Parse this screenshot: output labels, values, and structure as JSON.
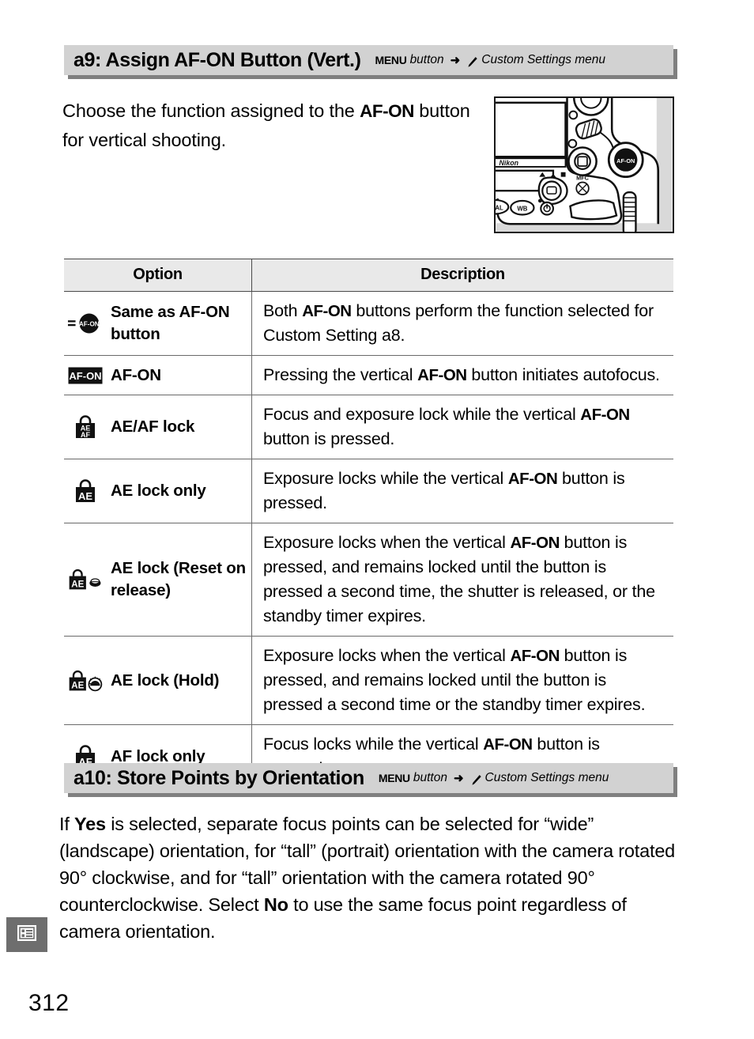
{
  "page": {
    "number": "312",
    "tab_icon": "menu-list-icon"
  },
  "sections": [
    {
      "id": "a9",
      "title": "a9: Assign AF-ON Button (Vert.)",
      "path": {
        "menu_label": "MENU",
        "button_word": "button",
        "arrow": "➜",
        "pencil_icon": "pencil-icon",
        "destination": "Custom Settings menu"
      },
      "intro_lead": "Choose the function assigned to the ",
      "intro_mono": "AF-ON",
      "intro_tail": " button for vertical shooting.",
      "figure": {
        "name": "camera-vertical-grip-illustration",
        "brand_text": "Nikon",
        "labels": [
          "AF-ON",
          "MFC",
          "WB",
          "QUAL"
        ]
      }
    },
    {
      "id": "a10",
      "title": "a10: Store Points by Orientation",
      "path": {
        "menu_label": "MENU",
        "button_word": "button",
        "arrow": "➜",
        "pencil_icon": "pencil-icon",
        "destination": "Custom Settings menu"
      },
      "body": [
        {
          "t": "If ",
          "b": false
        },
        {
          "t": "Yes",
          "b": true
        },
        {
          "t": " is selected, separate focus points can be selected for “wide” (landscape) orientation, for “tall” (portrait) orientation with the camera rotated 90° clockwise, and for “tall” orientation with the camera rotated 90° counterclockwise.  Select ",
          "b": false
        },
        {
          "t": "No",
          "b": true
        },
        {
          "t": " to use the same focus point regardless of camera orientation.",
          "b": false
        }
      ]
    }
  ],
  "table": {
    "headers": {
      "option": "Option",
      "description": "Description"
    },
    "rows": [
      {
        "icon": "equals-afon-circle-icon",
        "icon_text": "AF-ON",
        "label": "Same as AF-ON button",
        "desc_parts": [
          {
            "t": "Both ",
            "m": false
          },
          {
            "t": "AF-ON",
            "m": true
          },
          {
            "t": " buttons perform the function selected for Custom Setting a8.",
            "m": false
          }
        ]
      },
      {
        "icon": "afon-box-icon",
        "icon_text": "AF-ON",
        "label": "AF-ON",
        "desc_parts": [
          {
            "t": "Pressing the vertical ",
            "m": false
          },
          {
            "t": "AF-ON",
            "m": true
          },
          {
            "t": " button initiates autofocus.",
            "m": false
          }
        ]
      },
      {
        "icon": "padlock-ae-af-icon",
        "icon_text": "AE/AF",
        "label": "AE/AF lock",
        "desc_parts": [
          {
            "t": "Focus and exposure lock while the vertical ",
            "m": false
          },
          {
            "t": "AF-ON",
            "m": true
          },
          {
            "t": " button is pressed.",
            "m": false
          }
        ]
      },
      {
        "icon": "padlock-ae-icon",
        "icon_text": "AE",
        "label": "AE lock only",
        "desc_parts": [
          {
            "t": "Exposure locks while the vertical ",
            "m": false
          },
          {
            "t": "AF-ON",
            "m": true
          },
          {
            "t": " button is pressed.",
            "m": false
          }
        ]
      },
      {
        "icon": "padlock-ae-shutter-release-icon",
        "icon_text": "AE",
        "label": "AE lock (Reset on release)",
        "desc_parts": [
          {
            "t": "Exposure locks when the vertical ",
            "m": false
          },
          {
            "t": "AF-ON",
            "m": true
          },
          {
            "t": " button is pressed, and remains locked until the button is pressed a second time, the shutter is released, or the standby timer expires.",
            "m": false
          }
        ]
      },
      {
        "icon": "padlock-ae-timer-icon",
        "icon_text": "AE",
        "label": "AE lock (Hold)",
        "desc_parts": [
          {
            "t": "Exposure locks when the vertical ",
            "m": false
          },
          {
            "t": "AF-ON",
            "m": true
          },
          {
            "t": " button is pressed, and remains locked until the button is pressed a second time or the standby timer expires.",
            "m": false
          }
        ]
      },
      {
        "icon": "padlock-af-icon",
        "icon_text": "AF",
        "label": "AF lock only",
        "desc_parts": [
          {
            "t": "Focus locks while the vertical ",
            "m": false
          },
          {
            "t": "AF-ON",
            "m": true
          },
          {
            "t": " button is pressed.",
            "m": false
          }
        ]
      }
    ]
  },
  "colors": {
    "header_bar": "#d2d2d2",
    "header_shadow": "#808080",
    "table_header": "#e9e9e9",
    "rule": "#6a6a6a",
    "tab_marker": "#6e6e6e"
  }
}
